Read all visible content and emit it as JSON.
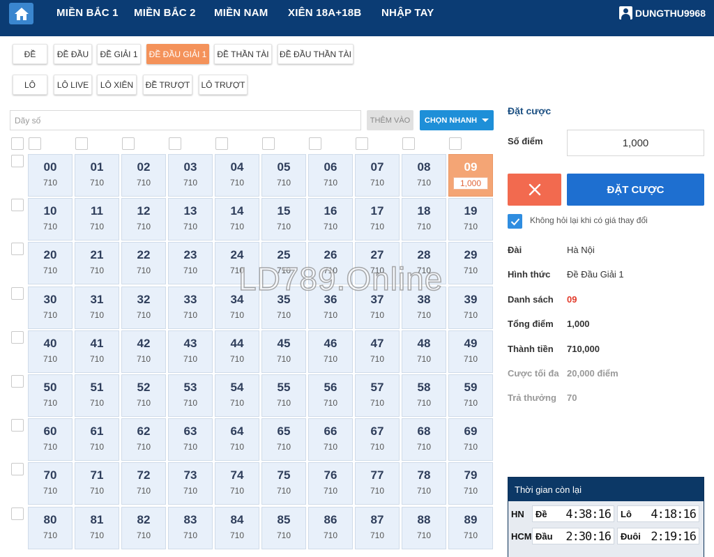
{
  "nav": {
    "home_icon": "home-icon",
    "items": [
      "MIỀN BẮC 1",
      "MIỀN BẮC 2",
      "MIỀN NAM",
      "XIÊN 18A+18B",
      "NHẬP TAY"
    ],
    "user": "DUNGTHU9968"
  },
  "tabs_row1": [
    "ĐỀ",
    "ĐỀ ĐẦU",
    "ĐỀ GIẢI 1",
    "ĐỀ ĐẦU GIẢI 1",
    "ĐỀ THẦN TÀI",
    "ĐỀ ĐẦU THẦN TÀI"
  ],
  "tabs_row2": [
    "LÔ",
    "LÔ LIVE",
    "LÔ XIÊN",
    "ĐỀ TRƯỢT",
    "LÔ TRƯỢT"
  ],
  "active_tab": "ĐỀ ĐẦU GIẢI 1",
  "search": {
    "placeholder": "Dãy số",
    "add_label": "THÊM VÀO",
    "quick_label": "CHỌN NHANH"
  },
  "grid": {
    "odds": "710",
    "selected_number": "09",
    "selected_points": "1,000",
    "visible_rows": 9
  },
  "watermark": "LD789.Online",
  "bet_panel": {
    "title": "Đặt cược",
    "points_label": "Số điểm",
    "points_value": "1,000",
    "bet_button": "ĐẶT CƯỢC",
    "cancel_icon": "close-icon",
    "no_ask_label": "Không hỏi lại khi có giá thay đổi",
    "details": [
      {
        "label": "Đài",
        "value": "Hà Nội",
        "style": "normal"
      },
      {
        "label": "Hình thức",
        "value": "Đề Đầu Giải 1",
        "style": "normal"
      },
      {
        "label": "Danh sách",
        "value": "09",
        "style": "red"
      },
      {
        "label": "Tổng điểm",
        "value": "1,000",
        "style": "bold"
      },
      {
        "label": "Thành tiền",
        "value": "710,000",
        "style": "bold"
      },
      {
        "label": "Cược tối đa",
        "value": "20,000 điểm",
        "style": "muted"
      },
      {
        "label": "Trả thưởng",
        "value": "70",
        "style": "muted"
      }
    ]
  },
  "timer": {
    "title": "Thời gian còn lại",
    "rows": [
      {
        "region": "HN",
        "a_label": "Đề",
        "a_time": "4:38:16",
        "b_label": "Lô",
        "b_time": "4:18:16"
      },
      {
        "region": "HCM",
        "a_label": "Đầu",
        "a_time": "2:30:16",
        "b_label": "Đuôi",
        "b_time": "2:19:16"
      }
    ]
  }
}
